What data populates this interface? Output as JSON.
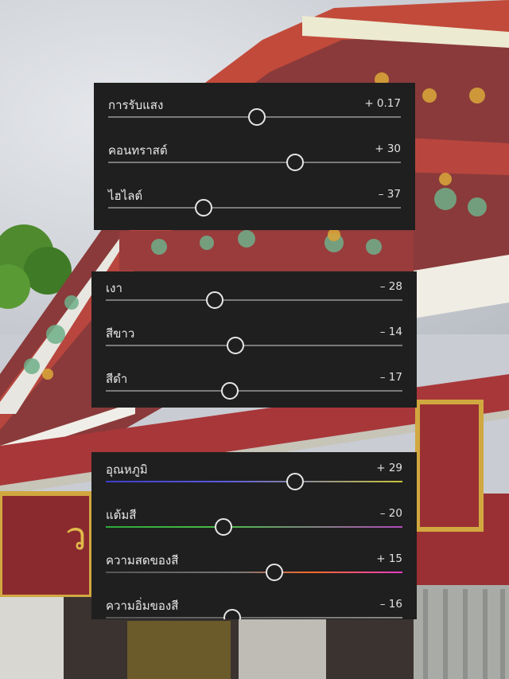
{
  "colors": {
    "panel_bg": "#1f1f1f",
    "text": "#e8e8e8",
    "track": "#7a7a7a",
    "knob_ring": "#e6e6e6"
  },
  "panels": [
    {
      "id": "light",
      "sliders": [
        {
          "label": "การรับแสง",
          "value": "+ 0.17",
          "position": 0.51
        },
        {
          "label": "คอนทราสต์",
          "value": "+ 30",
          "position": 0.64
        },
        {
          "label": "ไฮไลต์",
          "value": "– 37",
          "position": 0.33
        }
      ]
    },
    {
      "id": "tone",
      "sliders": [
        {
          "label": "เงา",
          "value": "– 28",
          "position": 0.37
        },
        {
          "label": "สีขาว",
          "value": "– 14",
          "position": 0.44
        },
        {
          "label": "สีดำ",
          "value": "– 17",
          "position": 0.42
        }
      ]
    },
    {
      "id": "color",
      "sliders": [
        {
          "label": "อุณหภูมิ",
          "value": "+ 29",
          "position": 0.64,
          "track": "temp"
        },
        {
          "label": "แต้มสี",
          "value": "– 20",
          "position": 0.4,
          "track": "tint"
        },
        {
          "label": "ความสดของสี",
          "value": "+ 15",
          "position": 0.57,
          "track": "vib"
        },
        {
          "label": "ความอิ่มของสี",
          "value": "– 16",
          "position": 0.43,
          "track": "sat"
        }
      ]
    }
  ]
}
